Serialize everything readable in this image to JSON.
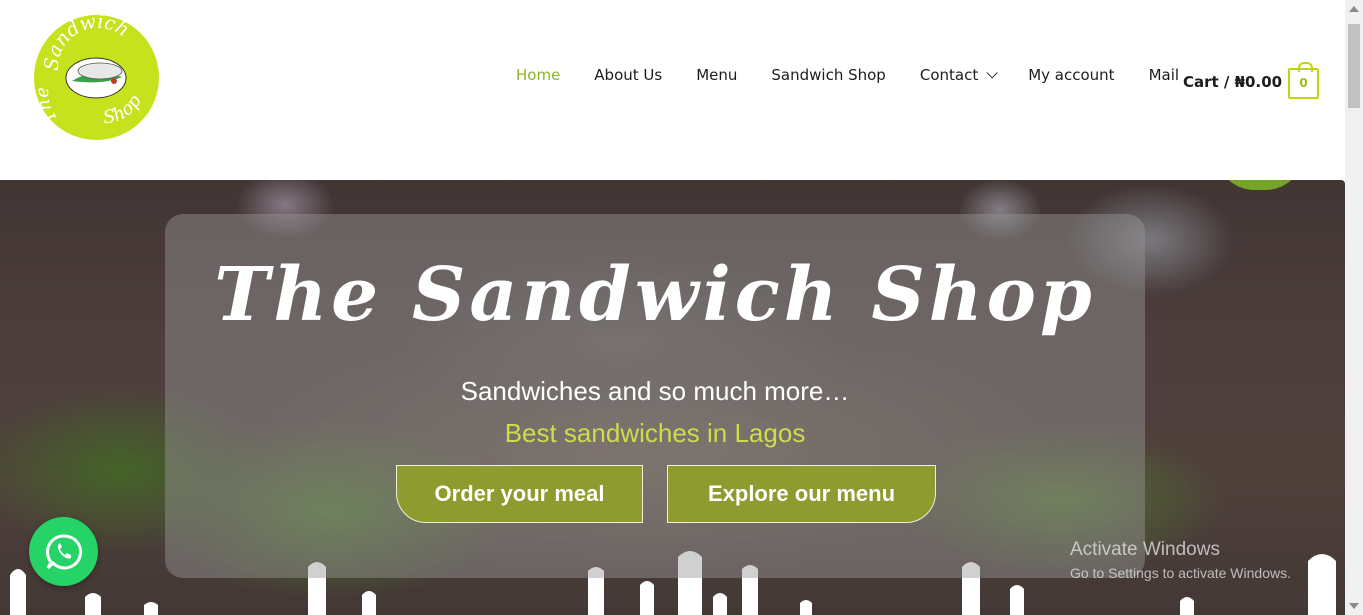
{
  "header": {
    "logo": {
      "text_top": "Sandwich",
      "text_left": "The",
      "text_bottom": "Shop",
      "color": "#c6e21c"
    },
    "nav": [
      {
        "label": "Home",
        "active": true
      },
      {
        "label": "About Us"
      },
      {
        "label": "Menu"
      },
      {
        "label": "Sandwich Shop"
      },
      {
        "label": "Contact",
        "has_dropdown": true
      },
      {
        "label": "My account"
      },
      {
        "label": "Mail"
      }
    ],
    "cart": {
      "label": "Cart / ₦0.00",
      "count": "0",
      "icon": "shopping-bag-icon"
    }
  },
  "hero": {
    "title": "The Sandwich Shop",
    "subtitle": "Sandwiches and so much more…",
    "tagline": "Best sandwiches in Lagos",
    "buttons": {
      "order": "Order your meal",
      "explore": "Explore our menu"
    }
  },
  "whatsapp": {
    "icon": "whatsapp-icon",
    "color": "#25d366"
  },
  "watermark": {
    "title": "Activate Windows",
    "sub": "Go to Settings to activate Windows."
  },
  "colors": {
    "accent": "#8db52a",
    "button": "#8d9b2f",
    "tagline": "#cfdc4a"
  }
}
